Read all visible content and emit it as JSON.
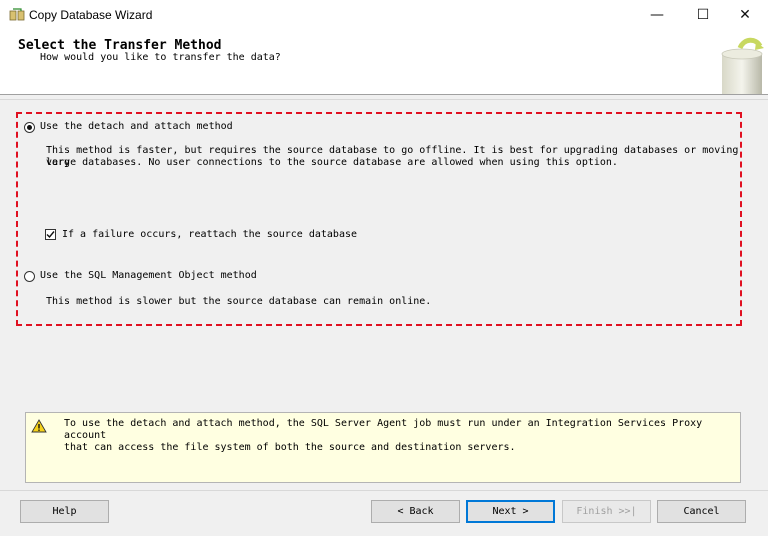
{
  "window": {
    "title": "Copy Database Wizard",
    "controls": {
      "minimize": "—",
      "maximize": "☐",
      "close": "✕"
    }
  },
  "header": {
    "title": "Select the Transfer Method",
    "subtitle": "How would you like to transfer the data?"
  },
  "options": {
    "detach": {
      "label": "Use the detach and attach method",
      "selected": true,
      "description_line1": "This method is faster, but requires the source database to go offline. It is best for upgrading databases or moving very",
      "description_line2": "large databases. No user connections to the source database are allowed when using this option.",
      "reattach": {
        "label": "If a failure occurs, reattach the source database",
        "checked": true
      }
    },
    "smo": {
      "label": "Use the SQL Management Object method",
      "selected": false,
      "description": "This method is slower but the source database can remain online."
    }
  },
  "warning": {
    "line1": "To use the detach and attach method, the SQL Server Agent job must run under an Integration Services Proxy account",
    "line2": "that can access the file system of both the source and destination servers."
  },
  "buttons": {
    "help": "Help",
    "back": "< Back",
    "next": "Next >",
    "finish": "Finish >>|",
    "cancel": "Cancel"
  },
  "colors": {
    "highlight_border": "#e01020",
    "warning_bg": "#ffffe1",
    "default_button": "#0078d7"
  }
}
